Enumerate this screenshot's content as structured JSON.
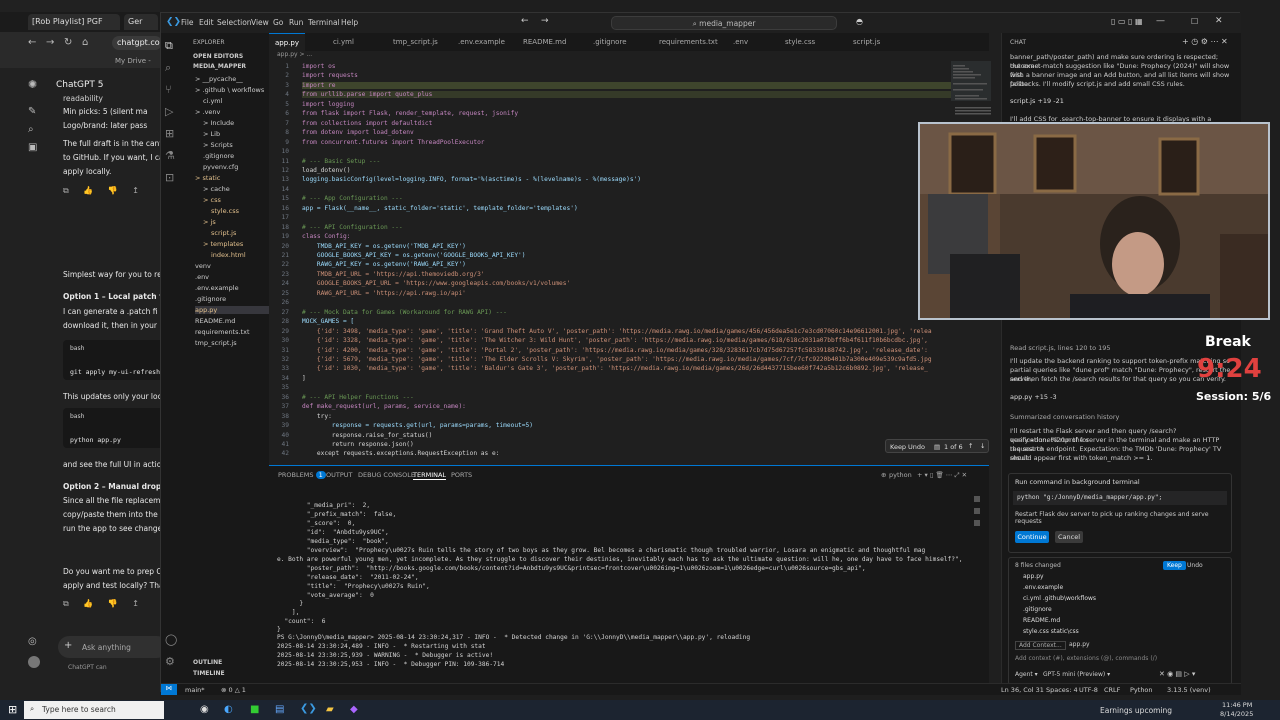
{
  "browser": {
    "tabs": [
      "[Rob Playlist] PGF",
      "Ger"
    ],
    "omnibox": "chatgpt.com",
    "bookmark": "My Drive -",
    "app_title": "ChatGPT 5",
    "chat_lines": [
      "readability",
      "Min picks: 5 (silent ma",
      "Logo/brand: later pass",
      "The full draft is in the canva",
      "to GitHub. If you want, I ca",
      "apply locally.",
      "Simplest way for you to rev",
      "Option 1 – Local patch file",
      "I can generate a .patch fi",
      "download it, then in your",
      "bash",
      "git apply my-ui-refresh",
      "This updates only your loca",
      "bash",
      "python app.py",
      "and see the full UI in action",
      "Option 2 – Manual drop-in",
      "Since all the file replacemer",
      "copy/paste them into the c",
      "run the app to see changes",
      "Do you want me to prep O",
      "apply and test locally? That"
    ],
    "ask_placeholder": "Ask anything",
    "footer": "ChatGPT can"
  },
  "vscode": {
    "menus": [
      "File",
      "Edit",
      "Selection",
      "View",
      "Go",
      "Run",
      "Terminal",
      "Help"
    ],
    "command_center": "media_mapper",
    "explorer_header": "EXPLORER",
    "open_editors": "OPEN EDITORS",
    "project": "MEDIA_MAPPER",
    "tree": [
      {
        "label": "> __pycache__",
        "m": false
      },
      {
        "label": "> .github \\ workflows",
        "m": false
      },
      {
        "label": "ci.yml",
        "m": false
      },
      {
        "label": "> .venv",
        "m": false
      },
      {
        "label": "> Include",
        "m": false
      },
      {
        "label": "> Lib",
        "m": false
      },
      {
        "label": "> Scripts",
        "m": false
      },
      {
        "label": ".gitignore",
        "m": false
      },
      {
        "label": "pyvenv.cfg",
        "m": false
      },
      {
        "label": "> static",
        "m": true
      },
      {
        "label": "> cache",
        "m": false
      },
      {
        "label": "> css",
        "m": true
      },
      {
        "label": "style.css",
        "m": true
      },
      {
        "label": "> js",
        "m": true
      },
      {
        "label": "script.js",
        "m": true
      },
      {
        "label": "> templates",
        "m": true
      },
      {
        "label": "index.html",
        "m": true
      },
      {
        "label": "venv",
        "m": false
      },
      {
        "label": ".env",
        "m": false
      },
      {
        "label": ".env.example",
        "m": false
      },
      {
        "label": ".gitignore",
        "m": false
      },
      {
        "label": "app.py",
        "m": true
      },
      {
        "label": "README.md",
        "m": false
      },
      {
        "label": "requirements.txt",
        "m": false
      },
      {
        "label": "tmp_script.js",
        "m": false
      }
    ],
    "outline": "OUTLINE",
    "timeline": "TIMELINE",
    "tabs": [
      "app.py",
      "ci.yml",
      "tmp_script.js",
      ".env.example",
      "README.md",
      ".gitignore",
      "requirements.txt",
      ".env",
      "style.css",
      "script.js"
    ],
    "breadcrumb": "app.py > ...",
    "code_lines": [
      {
        "n": "1",
        "t": "import os"
      },
      {
        "n": "2",
        "t": "import requests"
      },
      {
        "n": "3",
        "t": "import re"
      },
      {
        "n": "4",
        "t": "from urllib.parse import quote_plus"
      },
      {
        "n": "5",
        "t": "import logging"
      },
      {
        "n": "6",
        "t": "from flask import Flask, render_template, request, jsonify"
      },
      {
        "n": "7",
        "t": "from collections import defaultdict"
      },
      {
        "n": "8",
        "t": "from dotenv import load_dotenv"
      },
      {
        "n": "9",
        "t": "from concurrent.futures import ThreadPoolExecutor"
      },
      {
        "n": "10",
        "t": ""
      },
      {
        "n": "11",
        "t": "# --- Basic Setup ---"
      },
      {
        "n": "12",
        "t": "load_dotenv()"
      },
      {
        "n": "13",
        "t": "logging.basicConfig(level=logging.INFO, format='%(asctime)s - %(levelname)s - %(message)s')"
      },
      {
        "n": "14",
        "t": ""
      },
      {
        "n": "15",
        "t": "# --- App Configuration ---"
      },
      {
        "n": "16",
        "t": "app = Flask(__name__, static_folder='static', template_folder='templates')"
      },
      {
        "n": "17",
        "t": ""
      },
      {
        "n": "18",
        "t": "# --- API Configuration ---"
      },
      {
        "n": "19",
        "t": "class Config:"
      },
      {
        "n": "20",
        "t": "    TMDB_API_KEY = os.getenv('TMDB_API_KEY')"
      },
      {
        "n": "21",
        "t": "    GOOGLE_BOOKS_API_KEY = os.getenv('GOOGLE_BOOKS_API_KEY')"
      },
      {
        "n": "22",
        "t": "    RAWG_API_KEY = os.getenv('RAWG_API_KEY')"
      },
      {
        "n": "23",
        "t": "    TMDB_API_URL = 'https://api.themoviedb.org/3'"
      },
      {
        "n": "24",
        "t": "    GOOGLE_BOOKS_API_URL = 'https://www.googleapis.com/books/v1/volumes'"
      },
      {
        "n": "25",
        "t": "    RAWG_API_URL = 'https://api.rawg.io/api'"
      },
      {
        "n": "26",
        "t": ""
      },
      {
        "n": "27",
        "t": "# --- Mock Data for Games (Workaround for RAWG API) ---"
      },
      {
        "n": "28",
        "t": "MOCK_GAMES = ["
      },
      {
        "n": "29",
        "t": "    {'id': 3498, 'media_type': 'game', 'title': 'Grand Theft Auto V', 'poster_path': 'https://media.rawg.io/media/games/456/456dea5e1c7e3cd07060c14e96612001.jpg', 'relea"
      },
      {
        "n": "30",
        "t": "    {'id': 3328, 'media_type': 'game', 'title': 'The Witcher 3: Wild Hunt', 'poster_path': 'https://media.rawg.io/media/games/618/618c2031a07bbff6b4f611f10b6bcdbc.jpg',"
      },
      {
        "n": "31",
        "t": "    {'id': 4200, 'media_type': 'game', 'title': 'Portal 2', 'poster_path': 'https://media.rawg.io/media/games/328/3283617cb7d75d67257fc58339188742.jpg', 'release_date':"
      },
      {
        "n": "32",
        "t": "    {'id': 5679, 'media_type': 'game', 'title': 'The Elder Scrolls V: Skyrim', 'poster_path': 'https://media.rawg.io/media/games/7cf/7cfc9220b401b7a300e409e539c9afd5.jpg"
      },
      {
        "n": "33",
        "t": "    {'id': 1030, 'media_type': 'game', 'title': 'Baldur's Gate 3', 'poster_path': 'https://media.rawg.io/media/games/26d/26d4437715bee60f742a5b12c6b0892.jpg', 'release_"
      },
      {
        "n": "34",
        "t": "]"
      },
      {
        "n": "35",
        "t": ""
      },
      {
        "n": "36",
        "t": "# --- API Helper Functions ---"
      },
      {
        "n": "37",
        "t": "def make_request(url, params, service_name):"
      },
      {
        "n": "38",
        "t": "    try:"
      },
      {
        "n": "39",
        "t": "        response = requests.get(url, params=params, timeout=5)"
      },
      {
        "n": "40",
        "t": "        response.raise_for_status()"
      },
      {
        "n": "41",
        "t": "        return response.json()"
      },
      {
        "n": "42",
        "t": "    except requests.exceptions.RequestException as e:"
      }
    ],
    "keepbar": {
      "keep": "Keep",
      "undo": "Undo",
      "count": "1 of 6"
    },
    "panel_tabs": [
      "PROBLEMS",
      "OUTPUT",
      "DEBUG CONSOLE",
      "TERMINAL",
      "PORTS"
    ],
    "problems_count": "1",
    "terminal_shell": "python",
    "terminal_lines": [
      "        \"_media_pri\":  2,",
      "        \"_prefix_match\":  false,",
      "        \"_score\":  0,",
      "        \"id\":  \"Anbdtu9ys9UC\",",
      "        \"media_type\":  \"book\",",
      "        \"overview\":  \"Prophecy\\u0027s Ruin tells the story of two boys as they grow. Bel becomes a charismatic though troubled warrior, Losara an enigmatic and thoughtful mag",
      "e. Both are powerful young men, yet incomplete. As they struggle to discover their destinies, inevitably each has to ask the ultimate question: will he, one day have to face himself?\",",
      "        \"poster_path\":  \"http://books.google.com/books/content?id=Anbdtu9ys9UC&printsec=frontcover\\u0026img=1\\u0026zoom=1\\u0026edge=curl\\u0026source=gbs_api\",",
      "        \"release_date\":  \"2011-02-24\",",
      "        \"title\":  \"Prophecy\\u0027s Ruin\",",
      "        \"vote_average\":  0",
      "      }",
      "    ],",
      "  \"count\":  6",
      "}",
      "PS G:\\JonnyD\\media_mapper> 2025-08-14 23:30:24,317 - INFO -  * Detected change in 'G:\\\\JonnyD\\\\media_mapper\\\\app.py', reloading",
      "2025-08-14 23:30:24,489 - INFO -  * Restarting with stat",
      "2025-08-14 23:30:25,939 - WARNING -  * Debugger is active!",
      "2025-08-14 23:30:25,953 - INFO -  * Debugger PIN: 109-386-714"
    ],
    "status": {
      "branch": "main*",
      "errors": "⊗ 0 △ 1",
      "position": "Ln 36, Col 31",
      "spaces": "Spaces: 4",
      "encoding": "UTF-8",
      "eol": "CRLF",
      "language": "Python",
      "version": "3.13.5 (venv)"
    },
    "chat": {
      "header": "CHAT",
      "top_lines": [
        "banner_path/poster_path) and make sure ordering is respected; outcome:",
        "the exact-match suggestion like \"Dune: Prophecy (2024)\" will show first",
        "with a banner image and an Add button, and all list items will show poster",
        "fallbacks. I'll modify  script.js  and add small CSS rules."
      ],
      "file1": "script.js  +19  -21",
      "file1_note": "I'll add CSS for .search-top-banner to ensure it displays with a premium",
      "read_line": "Read  script.js, lines 120 to 195",
      "mid_lines": [
        "I'll update the backend ranking to support token-prefix matching so",
        "partial queries like \"dune prof\" match \"Dune: Prophecy\", restart the server,",
        "and then fetch the /search results for that query so you can verify."
      ],
      "file2": "app.py  +15  -3",
      "summary": "Summarized conversation history",
      "restart_lines": [
        "I'll restart the Flask server and then query /search?query=dune%20prof for",
        "verification. I'll run the server in the terminal and make an HTTP request to",
        "the search endpoint. Expectation: the TMDb 'Dune: Prophecy' TV result",
        "should appear first with token_match >= 1."
      ],
      "run_title": "Run command in background terminal",
      "run_cmd": "python  \"g:/JonnyD/media_mapper/app.py\";",
      "run_desc": "Restart Flask dev server to pick up ranking changes and serve requests",
      "continue": "Continue",
      "cancel": "Cancel",
      "files_changed": "8 files changed",
      "keep": "Keep",
      "undo": "Undo",
      "changed_files": [
        "app.py",
        ".env.example",
        "ci.yml  .github\\workflows",
        ".gitignore",
        "README.md",
        "style.css  static\\css"
      ],
      "add_context": "Add Context...",
      "context_file": "app.py",
      "input_placeholder": "Add context (#), extensions (@), commands (/)",
      "agent": "Agent ▾",
      "model": "GPT-5 mini (Preview) ▾"
    }
  },
  "overlay": {
    "break": "Break",
    "timer": "9:24",
    "session": "Session: 5/6"
  },
  "taskbar": {
    "search": "Type here to search",
    "earnings": "Earnings upcoming",
    "time": "11:46 PM",
    "date": "8/14/2025"
  }
}
